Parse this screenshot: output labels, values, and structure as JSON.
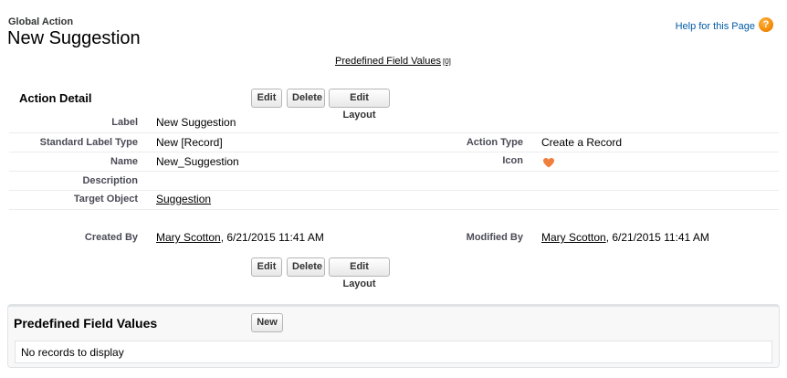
{
  "header": {
    "page_type": "Global Action",
    "title": "New Suggestion",
    "help_link": "Help for this Page",
    "help_icon": "question-mark-icon"
  },
  "related_links": {
    "predefined_label": "Predefined Field Values",
    "predefined_count": "[0]"
  },
  "detail": {
    "section_title": "Action Detail",
    "buttons": {
      "edit": "Edit",
      "delete": "Delete",
      "edit_layout": "Edit Layout"
    },
    "fields": {
      "label": {
        "label": "Label",
        "value": "New Suggestion"
      },
      "standard_label_type": {
        "label": "Standard Label Type",
        "value": "New [Record]"
      },
      "action_type": {
        "label": "Action Type",
        "value": "Create a Record"
      },
      "name": {
        "label": "Name",
        "value": "New_Suggestion"
      },
      "icon": {
        "label": "Icon",
        "value_icon": "heart-icon",
        "color": "#f07f3c"
      },
      "description": {
        "label": "Description",
        "value": ""
      },
      "target_object": {
        "label": "Target Object",
        "value": "Suggestion"
      },
      "created_by": {
        "label": "Created By",
        "user": "Mary Scotton",
        "date": ", 6/21/2015 11:41 AM"
      },
      "modified_by": {
        "label": "Modified By",
        "user": "Mary Scotton",
        "date": ", 6/21/2015 11:41 AM"
      }
    }
  },
  "related_list": {
    "title": "Predefined Field Values",
    "new_button": "New",
    "empty_message": "No records to display"
  },
  "colors": {
    "help_link": "#015ba7",
    "label_text": "#4a4a56",
    "help_icon": "#f48c06"
  }
}
